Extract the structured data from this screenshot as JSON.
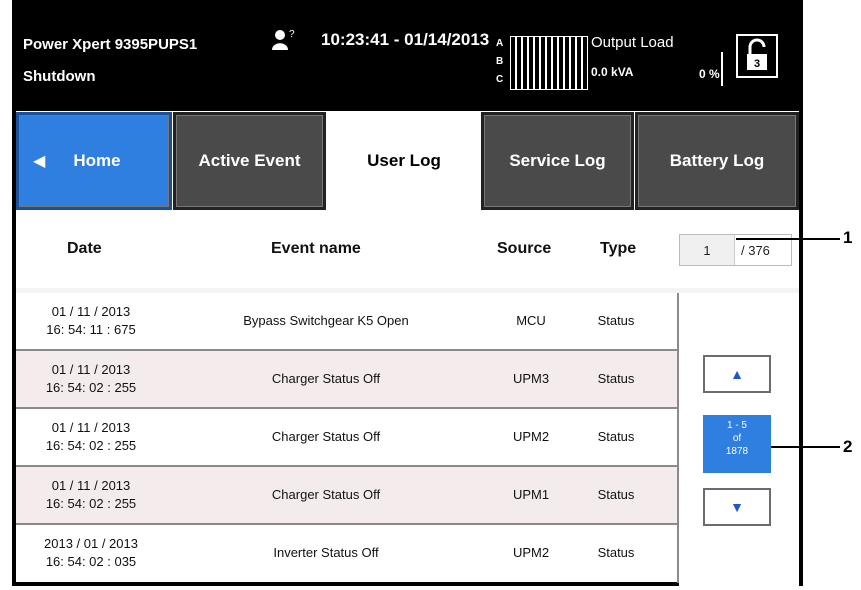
{
  "status_bar": {
    "model": "Power Xpert 9395PUPS1",
    "state": "Shutdown",
    "user_level": "?",
    "datetime": "10:23:41 - 01/14/2013",
    "phases": [
      "A",
      "B",
      "C"
    ],
    "output_load_label": "Output Load",
    "kva": "0.0 kVA",
    "percent": "0 %",
    "lock_digit": "3"
  },
  "tabs": {
    "home": "Home",
    "active_event": "Active Event",
    "user_log": "User Log",
    "service_log": "Service Log",
    "battery_log": "Battery Log"
  },
  "columns": {
    "date": "Date",
    "event": "Event name",
    "source": "Source",
    "type": "Type"
  },
  "pager": {
    "current": "1",
    "total": "/ 376"
  },
  "rows": [
    {
      "date": "01 / 11 / 2013",
      "time": "16: 54: 11 : 675",
      "event": "Bypass Switchgear K5 Open",
      "source": "MCU",
      "type": "Status"
    },
    {
      "date": "01 / 11 / 2013",
      "time": "16: 54: 02 : 255",
      "event": "Charger Status Off",
      "source": "UPM3",
      "type": "Status"
    },
    {
      "date": "01 / 11 / 2013",
      "time": "16: 54: 02 : 255",
      "event": "Charger Status Off",
      "source": "UPM2",
      "type": "Status"
    },
    {
      "date": "01 / 11 / 2013",
      "time": "16: 54: 02 : 255",
      "event": "Charger Status Off",
      "source": "UPM1",
      "type": "Status"
    },
    {
      "date": "2013 / 01 / 2013",
      "time": "16: 54: 02 : 035",
      "event": "Inverter Status Off",
      "source": "UPM2",
      "type": "Status"
    }
  ],
  "range": {
    "top": "1  -  5",
    "of": "of",
    "total": "1878"
  },
  "icons": {
    "up": "triangle-up",
    "down": "triangle-down",
    "home": "triangle-left",
    "lock": "unlock"
  },
  "colors": {
    "accent": "#2f7fe0",
    "tab_dark": "#4a4a4a",
    "row_alt": "#f4ecec"
  },
  "callouts": {
    "pager": "1",
    "range": "2"
  }
}
